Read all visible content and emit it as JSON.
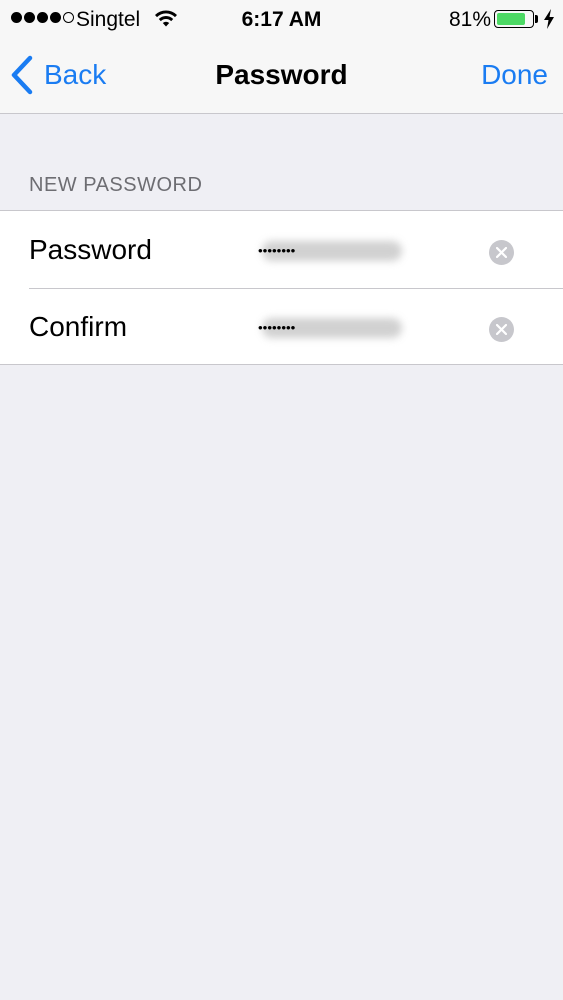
{
  "status_bar": {
    "carrier": "Singtel",
    "time": "6:17 AM",
    "battery_percent": "81%",
    "battery_level": 0.81,
    "signal_bars_filled": 4,
    "signal_bars_total": 5
  },
  "nav": {
    "back_label": "Back",
    "title": "Password",
    "done_label": "Done"
  },
  "section": {
    "header": "NEW PASSWORD"
  },
  "fields": [
    {
      "label": "Password",
      "value": "••••••••"
    },
    {
      "label": "Confirm",
      "value": "••••••••"
    }
  ],
  "colors": {
    "accent": "#1a7cf2",
    "background": "#efeff4",
    "battery": "#4cd964"
  },
  "icons": {
    "back": "chevron-left-icon",
    "clear": "clear-circle-icon",
    "wifi": "wifi-icon",
    "charging": "bolt-icon"
  }
}
